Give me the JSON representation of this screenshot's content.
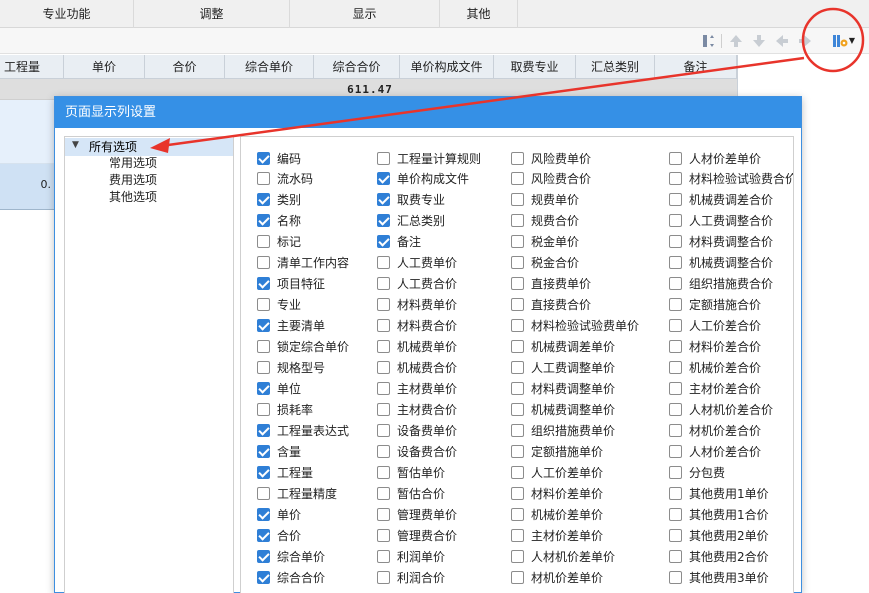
{
  "menubar": {
    "items": [
      {
        "label": "专业功能"
      },
      {
        "label": "调整"
      },
      {
        "label": "显示"
      },
      {
        "label": "其他"
      }
    ]
  },
  "toolbar": {
    "icons": [
      "sort-icon",
      "move-top-icon",
      "move-down-icon",
      "arrow-left-icon",
      "arrow-right-icon",
      "column-settings-icon",
      "dropdown-arrow-icon"
    ]
  },
  "grid": {
    "headers": [
      "工程量",
      "单价",
      "合价",
      "综合单价",
      "综合合价",
      "单价构成文件",
      "取费专业",
      "汇总类别",
      "备注"
    ],
    "total": "611.47",
    "row_partial_value": "0."
  },
  "dialog": {
    "title": "页面显示列设置",
    "tree": {
      "root": "所有选项",
      "children": [
        "常用选项",
        "费用选项",
        "其他选项"
      ]
    },
    "columns": [
      [
        {
          "label": "编码",
          "checked": true
        },
        {
          "label": "流水码",
          "checked": false
        },
        {
          "label": "类别",
          "checked": true
        },
        {
          "label": "名称",
          "checked": true
        },
        {
          "label": "标记",
          "checked": false
        },
        {
          "label": "清单工作内容",
          "checked": false
        },
        {
          "label": "项目特征",
          "checked": true
        },
        {
          "label": "专业",
          "checked": false
        },
        {
          "label": "主要清单",
          "checked": true
        },
        {
          "label": "锁定综合单价",
          "checked": false
        },
        {
          "label": "规格型号",
          "checked": false
        },
        {
          "label": "单位",
          "checked": true
        },
        {
          "label": "损耗率",
          "checked": false
        },
        {
          "label": "工程量表达式",
          "checked": true
        },
        {
          "label": "含量",
          "checked": true
        },
        {
          "label": "工程量",
          "checked": true
        },
        {
          "label": "工程量精度",
          "checked": false
        },
        {
          "label": "单价",
          "checked": true
        },
        {
          "label": "合价",
          "checked": true
        },
        {
          "label": "综合单价",
          "checked": true
        },
        {
          "label": "综合合价",
          "checked": true
        }
      ],
      [
        {
          "label": "工程量计算规则",
          "checked": false
        },
        {
          "label": "单价构成文件",
          "checked": true
        },
        {
          "label": "取费专业",
          "checked": true
        },
        {
          "label": "汇总类别",
          "checked": true
        },
        {
          "label": "备注",
          "checked": true
        },
        {
          "label": "人工费单价",
          "checked": false
        },
        {
          "label": "人工费合价",
          "checked": false
        },
        {
          "label": "材料费单价",
          "checked": false
        },
        {
          "label": "材料费合价",
          "checked": false
        },
        {
          "label": "机械费单价",
          "checked": false
        },
        {
          "label": "机械费合价",
          "checked": false
        },
        {
          "label": "主材费单价",
          "checked": false
        },
        {
          "label": "主材费合价",
          "checked": false
        },
        {
          "label": "设备费单价",
          "checked": false
        },
        {
          "label": "设备费合价",
          "checked": false
        },
        {
          "label": "暂估单价",
          "checked": false
        },
        {
          "label": "暂估合价",
          "checked": false
        },
        {
          "label": "管理费单价",
          "checked": false
        },
        {
          "label": "管理费合价",
          "checked": false
        },
        {
          "label": "利润单价",
          "checked": false
        },
        {
          "label": "利润合价",
          "checked": false
        }
      ],
      [
        {
          "label": "风险费单价",
          "checked": false
        },
        {
          "label": "风险费合价",
          "checked": false
        },
        {
          "label": "规费单价",
          "checked": false
        },
        {
          "label": "规费合价",
          "checked": false
        },
        {
          "label": "税金单价",
          "checked": false
        },
        {
          "label": "税金合价",
          "checked": false
        },
        {
          "label": "直接费单价",
          "checked": false
        },
        {
          "label": "直接费合价",
          "checked": false
        },
        {
          "label": "材料检验试验费单价",
          "checked": false
        },
        {
          "label": "机械费调差单价",
          "checked": false
        },
        {
          "label": "人工费调整单价",
          "checked": false
        },
        {
          "label": "材料费调整单价",
          "checked": false
        },
        {
          "label": "机械费调整单价",
          "checked": false
        },
        {
          "label": "组织措施费单价",
          "checked": false
        },
        {
          "label": "定额措施单价",
          "checked": false
        },
        {
          "label": "人工价差单价",
          "checked": false
        },
        {
          "label": "材料价差单价",
          "checked": false
        },
        {
          "label": "机械价差单价",
          "checked": false
        },
        {
          "label": "主材价差单价",
          "checked": false
        },
        {
          "label": "人材机价差单价",
          "checked": false
        },
        {
          "label": "材机价差单价",
          "checked": false
        }
      ],
      [
        {
          "label": "人材价差单价",
          "checked": false
        },
        {
          "label": "材料检验试验费合价",
          "checked": false
        },
        {
          "label": "机械费调差合价",
          "checked": false
        },
        {
          "label": "人工费调整合价",
          "checked": false
        },
        {
          "label": "材料费调整合价",
          "checked": false
        },
        {
          "label": "机械费调整合价",
          "checked": false
        },
        {
          "label": "组织措施费合价",
          "checked": false
        },
        {
          "label": "定额措施合价",
          "checked": false
        },
        {
          "label": "人工价差合价",
          "checked": false
        },
        {
          "label": "材料价差合价",
          "checked": false
        },
        {
          "label": "机械价差合价",
          "checked": false
        },
        {
          "label": "主材价差合价",
          "checked": false
        },
        {
          "label": "人材机价差合价",
          "checked": false
        },
        {
          "label": "材机价差合价",
          "checked": false
        },
        {
          "label": "人材价差合价",
          "checked": false
        },
        {
          "label": "分包费",
          "checked": false
        },
        {
          "label": "其他费用1单价",
          "checked": false
        },
        {
          "label": "其他费用1合价",
          "checked": false
        },
        {
          "label": "其他费用2单价",
          "checked": false
        },
        {
          "label": "其他费用2合价",
          "checked": false
        },
        {
          "label": "其他费用3单价",
          "checked": false
        }
      ]
    ]
  },
  "annotation": {
    "color": "#e8342b"
  }
}
